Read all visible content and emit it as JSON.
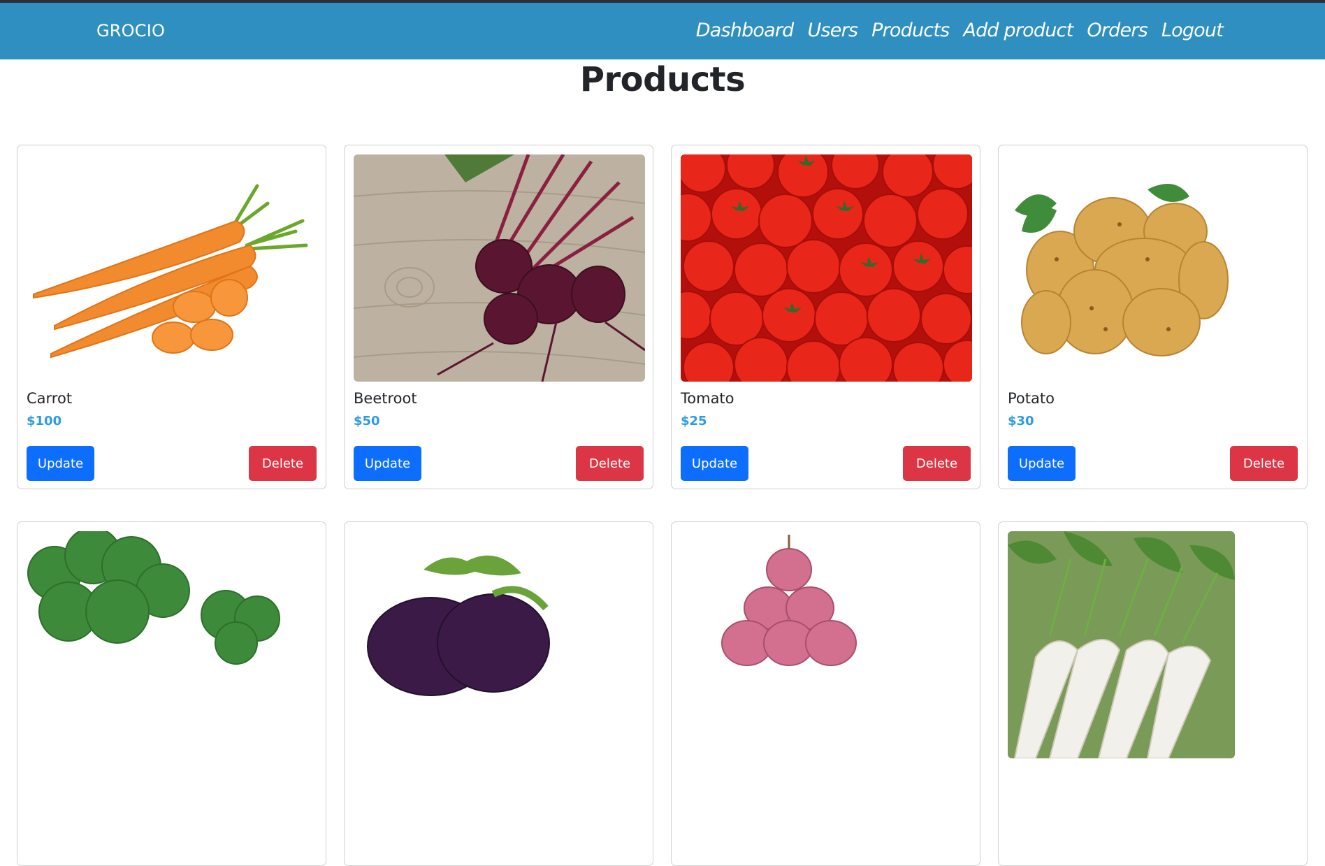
{
  "brand": "GROCIO",
  "nav": [
    "Dashboard",
    "Users",
    "Products",
    "Add product",
    "Orders",
    "Logout"
  ],
  "page_title": "Products",
  "buttons": {
    "update": "Update",
    "delete": "Delete"
  },
  "products": [
    {
      "name": "Carrot",
      "price": "$100",
      "image": "carrot"
    },
    {
      "name": "Beetroot",
      "price": "$50",
      "image": "beetroot"
    },
    {
      "name": "Tomato",
      "price": "$25",
      "image": "tomato"
    },
    {
      "name": "Potato",
      "price": "$30",
      "image": "potato"
    },
    {
      "name": "",
      "price": "",
      "image": "broccoli"
    },
    {
      "name": "",
      "price": "",
      "image": "eggplant"
    },
    {
      "name": "",
      "price": "",
      "image": "onion"
    },
    {
      "name": "",
      "price": "",
      "image": "radish"
    }
  ]
}
